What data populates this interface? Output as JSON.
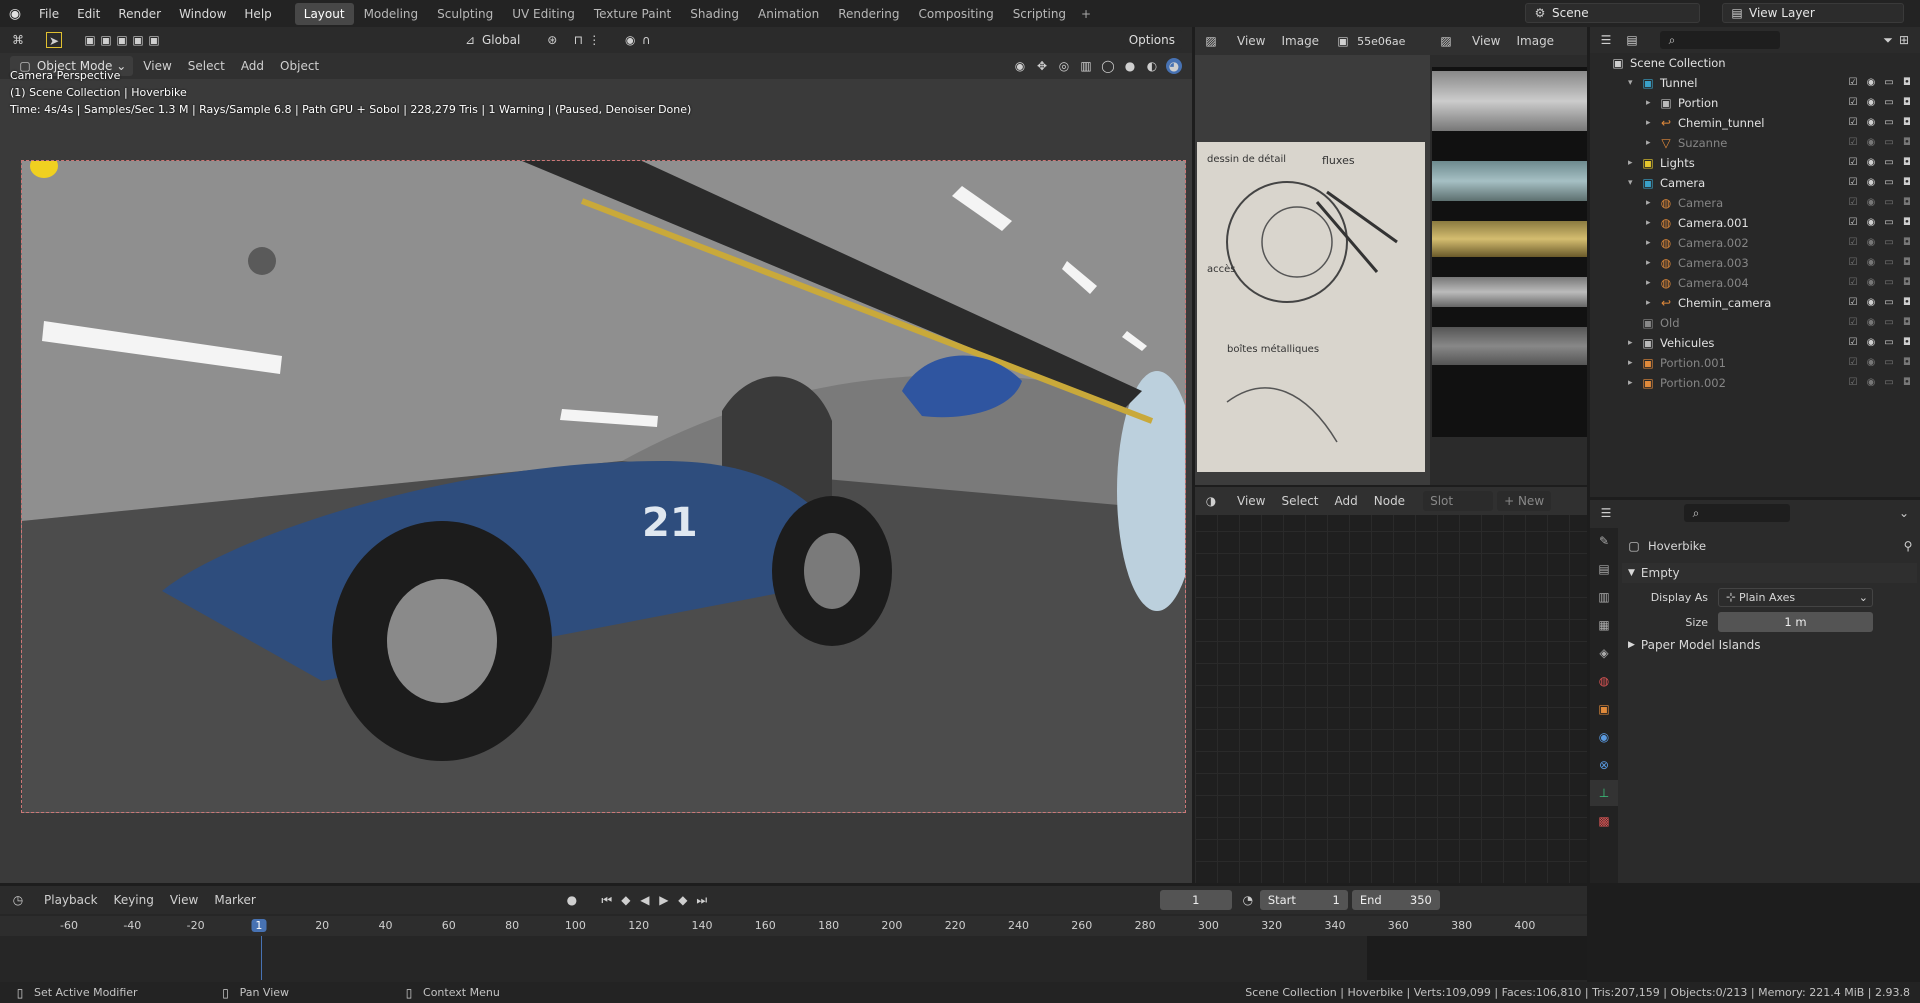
{
  "menu": [
    "File",
    "Edit",
    "Render",
    "Window",
    "Help"
  ],
  "workspace_tabs": [
    "Layout",
    "Modeling",
    "Sculpting",
    "UV Editing",
    "Texture Paint",
    "Shading",
    "Animation",
    "Rendering",
    "Compositing",
    "Scripting"
  ],
  "active_tab": "Layout",
  "scene_name": "Scene",
  "view_layer": "View Layer",
  "viewport": {
    "mode": "Object Mode",
    "header_menu": [
      "View",
      "Select",
      "Add",
      "Object"
    ],
    "transform": "Global",
    "options": "Options",
    "overlay_line1": "Camera Perspective",
    "overlay_line2": "(1) Scene Collection | Hoverbike",
    "overlay_line3": "Time: 4s/4s | Samples/Sec 1.3 M | Rays/Sample 6.8 | Path GPU + Sobol | 228,279 Tris | 1 Warning | (Paused, Denoiser Done)",
    "car_number": "21"
  },
  "image_editor": {
    "menu": [
      "View",
      "Image"
    ],
    "image_name": "55e06ae",
    "sketch_notes": [
      "dessin de détail",
      "fluxes",
      "accès",
      "boîtes métalliques"
    ]
  },
  "image_editor2": {
    "menu": [
      "View",
      "Image"
    ]
  },
  "node_editor": {
    "menu": [
      "View",
      "Select",
      "Add",
      "Node"
    ],
    "slot": "Slot",
    "new": "New"
  },
  "outliner": {
    "root": "Scene Collection",
    "rows": [
      {
        "name": "Tunnel",
        "indent": 1,
        "dim": false,
        "expand": "▾",
        "color": "#3aa1c9",
        "icon": "▣"
      },
      {
        "name": "Portion",
        "indent": 2,
        "dim": false,
        "expand": "▸",
        "color": "#bbbbbb",
        "icon": "▣"
      },
      {
        "name": "Chemin_tunnel",
        "indent": 2,
        "dim": false,
        "expand": "▸",
        "color": "#e08a3b",
        "icon": "↩"
      },
      {
        "name": "Suzanne",
        "indent": 2,
        "dim": true,
        "expand": "▸",
        "color": "#e08a3b",
        "icon": "▽"
      },
      {
        "name": "Lights",
        "indent": 1,
        "dim": false,
        "expand": "▸",
        "color": "#e6c72d",
        "icon": "▣"
      },
      {
        "name": "Camera",
        "indent": 1,
        "dim": false,
        "expand": "▾",
        "color": "#3aa1c9",
        "icon": "▣"
      },
      {
        "name": "Camera",
        "indent": 2,
        "dim": true,
        "expand": "▸",
        "color": "#e08a3b",
        "icon": "◍"
      },
      {
        "name": "Camera.001",
        "indent": 2,
        "dim": false,
        "expand": "▸",
        "color": "#e08a3b",
        "icon": "◍"
      },
      {
        "name": "Camera.002",
        "indent": 2,
        "dim": true,
        "expand": "▸",
        "color": "#e08a3b",
        "icon": "◍"
      },
      {
        "name": "Camera.003",
        "indent": 2,
        "dim": true,
        "expand": "▸",
        "color": "#e08a3b",
        "icon": "◍"
      },
      {
        "name": "Camera.004",
        "indent": 2,
        "dim": true,
        "expand": "▸",
        "color": "#e08a3b",
        "icon": "◍"
      },
      {
        "name": "Chemin_camera",
        "indent": 2,
        "dim": false,
        "expand": "▸",
        "color": "#e08a3b",
        "icon": "↩"
      },
      {
        "name": "Old",
        "indent": 1,
        "dim": true,
        "expand": "",
        "color": "#888888",
        "icon": "▣"
      },
      {
        "name": "Vehicules",
        "indent": 1,
        "dim": false,
        "expand": "▸",
        "color": "#bbbbbb",
        "icon": "▣"
      },
      {
        "name": "Portion.001",
        "indent": 1,
        "dim": true,
        "expand": "▸",
        "color": "#e08a3b",
        "icon": "▣"
      },
      {
        "name": "Portion.002",
        "indent": 1,
        "dim": true,
        "expand": "▸",
        "color": "#e08a3b",
        "icon": "▣"
      }
    ]
  },
  "properties": {
    "object_name": "Hoverbike",
    "panel_empty": "Empty",
    "display_as_label": "Display As",
    "display_as_value": "Plain Axes",
    "size_label": "Size",
    "size_value": "1 m",
    "panel_paper": "Paper Model Islands"
  },
  "timeline": {
    "menu": [
      "Playback",
      "Keying",
      "View",
      "Marker"
    ],
    "current_frame": "1",
    "start_label": "Start",
    "start": "1",
    "end_label": "End",
    "end": "350",
    "ticks": [
      "-60",
      "-40",
      "-20",
      "1",
      "20",
      "40",
      "60",
      "80",
      "100",
      "120",
      "140",
      "160",
      "180",
      "200",
      "220",
      "240",
      "260",
      "280",
      "300",
      "320",
      "340",
      "360",
      "380",
      "400"
    ]
  },
  "status": {
    "left1": "Set Active Modifier",
    "left2": "Pan View",
    "left3": "Context Menu",
    "right": "Scene Collection | Hoverbike | Verts:109,099 | Faces:106,810 | Tris:207,159 | Objects:0/213 | Memory: 221.4 MiB | 2.93.8"
  }
}
